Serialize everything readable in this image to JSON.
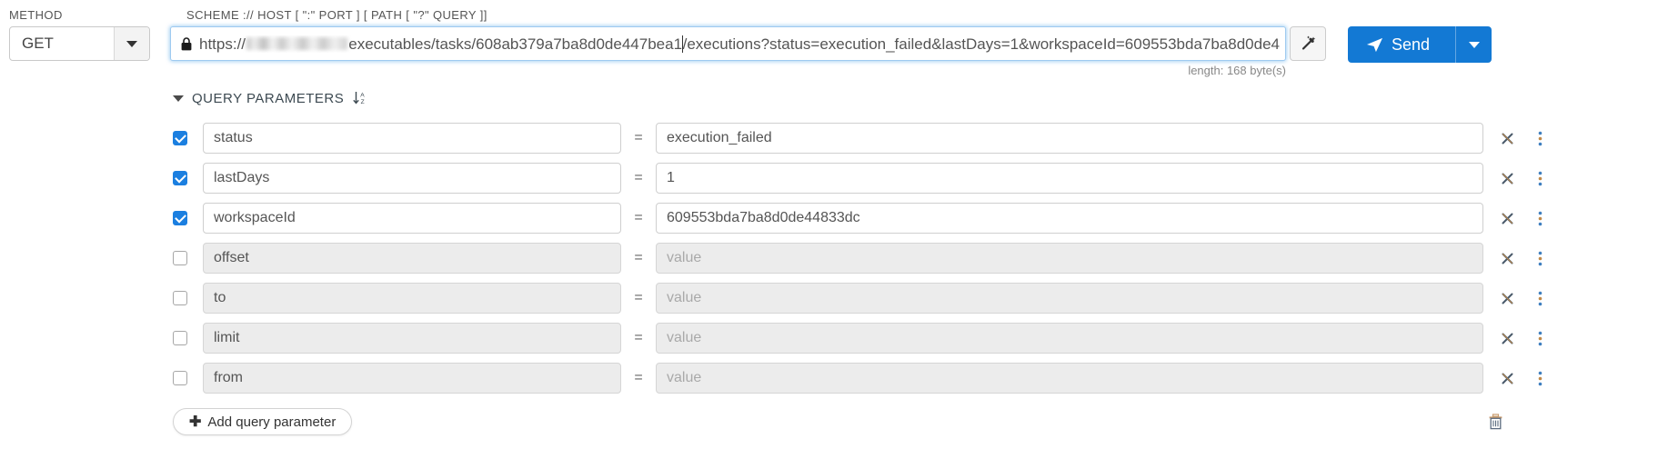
{
  "request": {
    "method_label": "METHOD",
    "method_value": "GET",
    "url_label": "SCHEME :// HOST [ \":\" PORT ] [ PATH [ \"?\" QUERY ]]",
    "url_scheme": "https://",
    "url_redacted": true,
    "url_before_caret": "executables/tasks/608ab379a7ba8d0de447bea1",
    "url_after_caret": "/executions?status=execution_failed&lastDays=1&workspaceId=609553bda7ba8d0de4",
    "length_note": "length: 168 byte(s)",
    "send_label": "Send",
    "icons": {
      "lock": "lock-icon",
      "wand": "magic-wand-icon",
      "send": "paper-plane-icon",
      "method_caret": "chevron-down-icon",
      "send_caret": "chevron-down-icon"
    }
  },
  "query_parameters": {
    "section_title": "QUERY PARAMETERS",
    "collapse_icon": "triangle-down-icon",
    "sort_icon": "sort-az-icon",
    "equals_sign": "=",
    "value_placeholder": "value",
    "add_label": "Add query parameter",
    "add_icon": "plus-icon",
    "delete_all_icon": "trash-icon",
    "row_remove_icon": "close-icon",
    "row_menu_icon": "more-vertical-icon",
    "rows": [
      {
        "enabled": true,
        "key": "status",
        "value": "execution_failed"
      },
      {
        "enabled": true,
        "key": "lastDays",
        "value": "1"
      },
      {
        "enabled": true,
        "key": "workspaceId",
        "value": "609553bda7ba8d0de44833dc"
      },
      {
        "enabled": false,
        "key": "offset",
        "value": ""
      },
      {
        "enabled": false,
        "key": "to",
        "value": ""
      },
      {
        "enabled": false,
        "key": "limit",
        "value": ""
      },
      {
        "enabled": false,
        "key": "from",
        "value": ""
      }
    ]
  },
  "colors": {
    "accent": "#1379d4",
    "checkbox_on": "#1b7fe0",
    "focus_ring": "#66afe9",
    "disabled_bg": "#ececec"
  }
}
